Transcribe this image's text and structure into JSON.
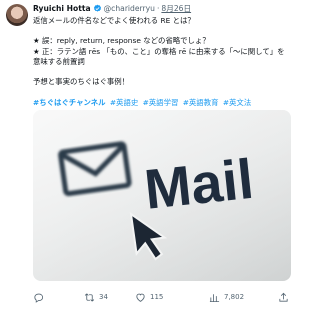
{
  "tweet": {
    "author_name": "Ryuichi Hotta",
    "handle": "@chariderryu",
    "separator": "·",
    "date": "8月26日",
    "body_lines": [
      "返信メールの件名などでよく使われる RE とは？",
      "",
      "★ 誤：reply, return, response などの省略でしょ？",
      "★ 正：ラテン語 rēs 「もの、こと」の奪格 rē に由来する「～に関して」を",
      "意味する前置詞",
      "",
      "予想と事実のちぐはぐ事例！"
    ],
    "hashtags": [
      "#ちぐはぐチャンネル",
      "#英語史",
      "#英語学習",
      "#英語教育",
      "#英文法"
    ],
    "media_text": "Mail",
    "actions": {
      "replies": "",
      "retweets": "34",
      "likes": "115",
      "views": "7,802",
      "share": ""
    },
    "colors": {
      "link": "#1d9bf0",
      "muted": "#536471",
      "text": "#0f1419"
    },
    "icons": [
      "verified-badge-icon",
      "reply-icon",
      "retweet-icon",
      "like-icon",
      "views-icon",
      "share-icon",
      "envelope-icon",
      "cursor-arrow-icon"
    ]
  }
}
